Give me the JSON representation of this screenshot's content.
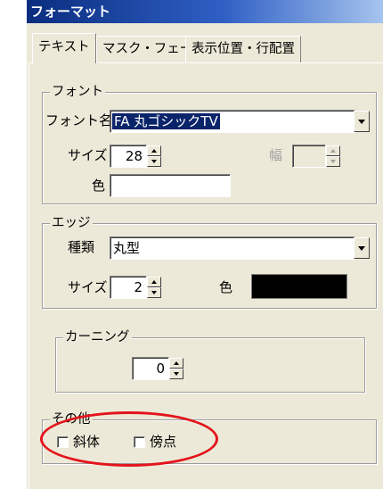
{
  "window": {
    "title": "フォーマット"
  },
  "tabs": [
    {
      "label": "テキスト",
      "active": true
    },
    {
      "label": "マスク・フェード",
      "active": false
    },
    {
      "label": "表示位置・行配置",
      "active": false
    }
  ],
  "font_group": {
    "legend": "フォント",
    "font_name_label": "フォント名",
    "font_name_value": "FA 丸ゴシックTV",
    "size_label": "サイズ",
    "size_value": "28",
    "width_label": "幅",
    "width_value": "",
    "color_label": "色",
    "color_value": "#ffffff"
  },
  "edge_group": {
    "legend": "エッジ",
    "type_label": "種類",
    "type_value": "丸型",
    "size_label": "サイズ",
    "size_value": "2",
    "color_label": "色",
    "color_value": "#000000"
  },
  "kerning_group": {
    "legend": "カーニング",
    "value": "0"
  },
  "other_group": {
    "legend": "その他",
    "italic_label": "斜体",
    "italic_checked": false,
    "emphasis_dot_label": "傍点",
    "emphasis_dot_checked": false
  },
  "annotation": {
    "color": "#e3141c",
    "shape": "ellipse"
  }
}
